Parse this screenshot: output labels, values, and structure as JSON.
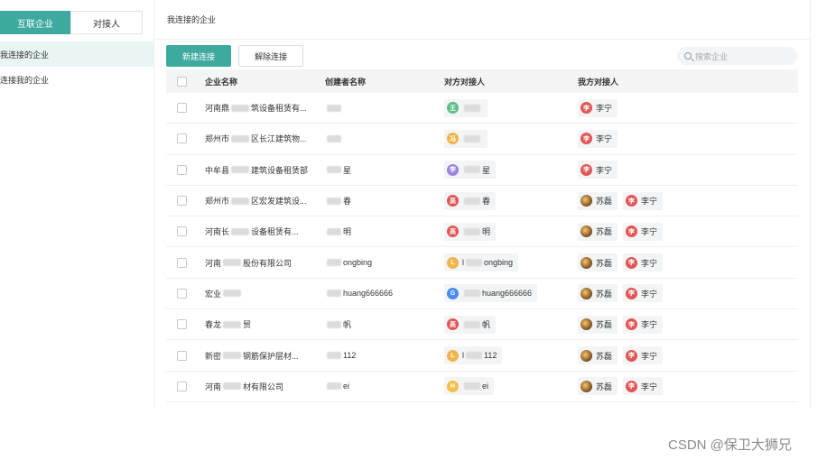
{
  "sidebar": {
    "tabs": [
      {
        "label": "互联企业",
        "active": true
      },
      {
        "label": "对接人",
        "active": false
      }
    ],
    "items": [
      {
        "label": "我连接的企业",
        "active": true
      },
      {
        "label": "连接我的企业",
        "active": false
      }
    ]
  },
  "main": {
    "title": "我连接的企业",
    "toolbar": {
      "new_label": "新建连接",
      "remove_label": "解除连接",
      "search_placeholder": "搜索企业"
    },
    "columns": [
      "企业名称",
      "创建者名称",
      "对方对接人",
      "我方对接人"
    ]
  },
  "rows": [
    {
      "company": [
        "河南鼎",
        "筑设备租赁有..."
      ],
      "creator": [
        "",
        ""
      ],
      "peer": {
        "initial": "王",
        "color": "green",
        "text": [
          "",
          ""
        ]
      },
      "mine": [
        {
          "initial": "李",
          "color": "red",
          "name": "李宁"
        }
      ]
    },
    {
      "company": [
        "郑州市",
        "区长江建筑物..."
      ],
      "creator": [
        "",
        ""
      ],
      "peer": {
        "initial": "冯",
        "color": "orange",
        "text": [
          "",
          ""
        ]
      },
      "mine": [
        {
          "initial": "李",
          "color": "red",
          "name": "李宁"
        }
      ]
    },
    {
      "company": [
        "中牟县",
        "建筑设备租赁部"
      ],
      "creator": [
        "",
        "星"
      ],
      "peer": {
        "initial": "李",
        "color": "purple",
        "text": [
          "",
          "星"
        ]
      },
      "mine": [
        {
          "initial": "李",
          "color": "red",
          "name": "李宁"
        }
      ]
    },
    {
      "company": [
        "郑州市",
        "区宏发建筑设..."
      ],
      "creator": [
        "",
        "春"
      ],
      "peer": {
        "initial": "高",
        "color": "red",
        "text": [
          "",
          "春"
        ]
      },
      "mine": [
        {
          "initial": "苏",
          "color": "photo",
          "name": "苏磊"
        },
        {
          "initial": "李",
          "color": "red",
          "name": "李宁"
        }
      ]
    },
    {
      "company": [
        "河南长",
        "设备租赁有..."
      ],
      "creator": [
        "",
        "明"
      ],
      "peer": {
        "initial": "高",
        "color": "red",
        "text": [
          "",
          "明"
        ]
      },
      "mine": [
        {
          "initial": "苏",
          "color": "photo",
          "name": "苏磊"
        },
        {
          "initial": "李",
          "color": "red",
          "name": "李宁"
        }
      ]
    },
    {
      "company": [
        "河南",
        "股份有限公司"
      ],
      "creator": [
        "",
        "ongbing"
      ],
      "peer": {
        "initial": "L",
        "color": "orange",
        "text": [
          "l",
          "ongbing"
        ]
      },
      "mine": [
        {
          "initial": "苏",
          "color": "photo",
          "name": "苏磊"
        },
        {
          "initial": "李",
          "color": "red",
          "name": "李宁"
        }
      ]
    },
    {
      "company": [
        "宏业",
        ""
      ],
      "creator": [
        "",
        "huang666666"
      ],
      "peer": {
        "initial": "G",
        "color": "blue",
        "text": [
          "",
          "huang666666"
        ]
      },
      "mine": [
        {
          "initial": "苏",
          "color": "photo",
          "name": "苏磊"
        },
        {
          "initial": "李",
          "color": "red",
          "name": "李宁"
        }
      ]
    },
    {
      "company": [
        "春龙",
        "贸"
      ],
      "creator": [
        "",
        "帆"
      ],
      "peer": {
        "initial": "高",
        "color": "red",
        "text": [
          "",
          "帆"
        ]
      },
      "mine": [
        {
          "initial": "苏",
          "color": "photo",
          "name": "苏磊"
        },
        {
          "initial": "李",
          "color": "red",
          "name": "李宁"
        }
      ]
    },
    {
      "company": [
        "新密",
        "钢筋保护层材..."
      ],
      "creator": [
        "",
        "112"
      ],
      "peer": {
        "initial": "L",
        "color": "orange",
        "text": [
          "l",
          "112"
        ]
      },
      "mine": [
        {
          "initial": "苏",
          "color": "photo",
          "name": "苏磊"
        },
        {
          "initial": "李",
          "color": "red",
          "name": "李宁"
        }
      ]
    },
    {
      "company": [
        "河南",
        "材有限公司"
      ],
      "creator": [
        "",
        "ei"
      ],
      "peer": {
        "initial": "H",
        "color": "yellow",
        "text": [
          "",
          "ei"
        ]
      },
      "mine": [
        {
          "initial": "苏",
          "color": "photo",
          "name": "苏磊"
        },
        {
          "initial": "李",
          "color": "red",
          "name": "李宁"
        }
      ]
    }
  ],
  "watermark": "CSDN @保卫大狮兄"
}
